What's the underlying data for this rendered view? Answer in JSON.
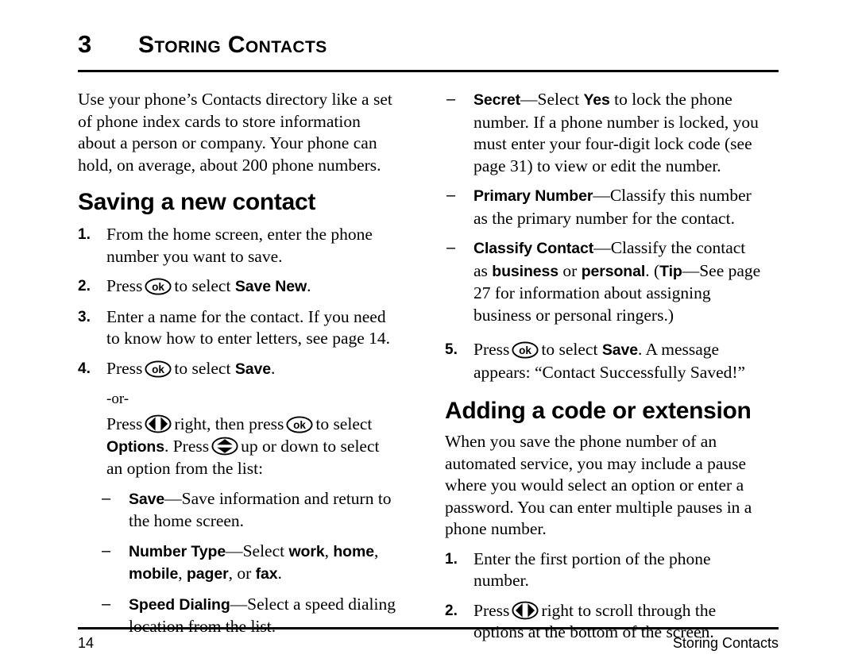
{
  "header": {
    "chapter_number": "3",
    "chapter_title": "Storing Contacts"
  },
  "footer": {
    "page_number": "14",
    "running_title": "Storing Contacts"
  },
  "left_column": {
    "intro": "Use your phone’s Contacts directory like a set of phone index cards to store information about a person or company. Your phone can hold, on average, about 200 phone numbers.",
    "section_heading": "Saving a new contact",
    "step1": {
      "num": "1.",
      "text": "From the home screen, enter the phone number you want to save."
    },
    "step2": {
      "num": "2.",
      "pre": "Press",
      "mid": "to select",
      "bold": "Save New",
      "post": "."
    },
    "step3": {
      "num": "3.",
      "text": "Enter a name for the contact. If you need to know how to enter letters, see page 14."
    },
    "step4": {
      "num": "4.",
      "pre": "Press",
      "mid": "to select",
      "bold": "Save",
      "post": "."
    },
    "or_label": "-or-",
    "or_text": {
      "pre": "Press",
      "mid1": "right, then press",
      "mid2": "to select",
      "bold1": "Options",
      "mid3": ". Press",
      "mid4": "up or down to select an option from the list:"
    },
    "options": [
      {
        "dash": "–",
        "term": "Save",
        "sep": "—",
        "desc": "Save information and return to the home screen."
      },
      {
        "dash": "–",
        "term": "Number Type",
        "sep": "—",
        "desc_pre": "Select ",
        "bold_items": [
          "work",
          "home",
          "mobile",
          "pager",
          "fax"
        ],
        "desc_tail": "."
      },
      {
        "dash": "–",
        "term": "Speed Dialing",
        "sep": "—",
        "desc": "Select a speed dialing location from the list."
      }
    ]
  },
  "right_column": {
    "options": [
      {
        "dash": "–",
        "term": "Secret",
        "sep": "—",
        "desc_pre": "Select ",
        "bold_inline": "Yes",
        "desc_post": " to lock the phone number. If a phone number is locked, you must enter your four-digit lock code (see page 31) to view or edit the number."
      },
      {
        "dash": "–",
        "term": "Primary Number",
        "sep": "—",
        "desc": "Classify this number as the primary number for the contact."
      },
      {
        "dash": "–",
        "term": "Classify Contact",
        "sep": "—",
        "desc_a": "Classify the contact as ",
        "bold_b": "business",
        "desc_c": " or ",
        "bold_d": "personal",
        "desc_e": ". (",
        "bold_f": "Tip",
        "desc_g": "—See page 27 for information about assigning business or personal ringers.)"
      }
    ],
    "step5": {
      "num": "5.",
      "pre": "Press",
      "mid": "to select",
      "bold": "Save",
      "post": ". A message appears: “Contact Successfully Saved!”"
    },
    "section_heading": "Adding a code or extension",
    "para": "When you save the phone number of an automated service, you may include a pause where you would select an option or enter a password. You can enter multiple pauses in a phone number.",
    "step1": {
      "num": "1.",
      "text": "Enter the first portion of the phone number."
    },
    "step2": {
      "num": "2.",
      "pre": "Press",
      "post": "right to scroll through the options at the bottom of the screen."
    }
  },
  "icons": {
    "ok_key": "ok",
    "ok_key_name": "ok-key-icon",
    "leftright_key_name": "left-right-navigation-key-icon",
    "updown_key_name": "up-down-navigation-key-icon"
  },
  "colors": {
    "ink": "#000000",
    "paper": "#ffffff"
  }
}
